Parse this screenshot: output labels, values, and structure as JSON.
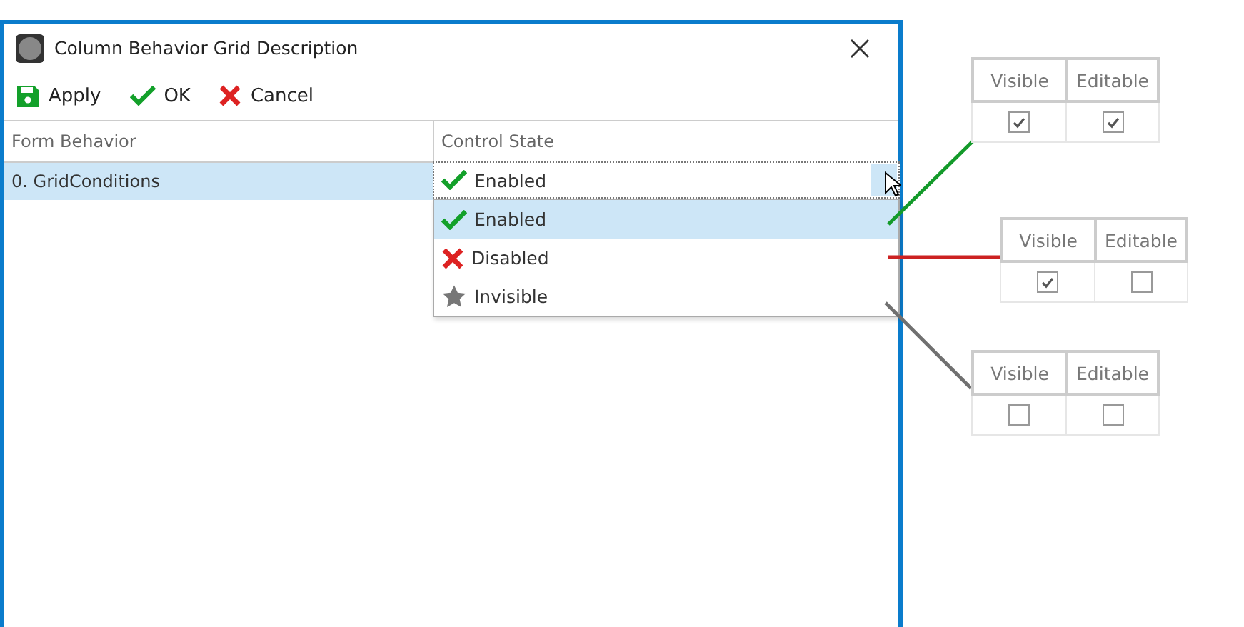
{
  "window": {
    "title": "Column Behavior Grid Description"
  },
  "toolbar": [
    {
      "label": "Apply",
      "kind": "save"
    },
    {
      "label": "OK",
      "kind": "ok"
    },
    {
      "label": "Cancel",
      "kind": "cancel"
    }
  ],
  "grid": {
    "columns": [
      "Form Behavior",
      "Control State"
    ],
    "rows": [
      {
        "form_behavior": "0. GridConditions",
        "control_state": "Enabled",
        "kind": "enabled",
        "selected": true
      }
    ]
  },
  "dropdown": {
    "options": [
      {
        "label": "Enabled",
        "kind": "enabled",
        "selected": true
      },
      {
        "label": "Disabled",
        "kind": "disabled",
        "selected": false
      },
      {
        "label": "Invisible",
        "kind": "invisible",
        "selected": false
      }
    ]
  },
  "callouts": [
    {
      "columns": [
        "Visible",
        "Editable"
      ],
      "visible": true,
      "editable": true,
      "color": "#139a2a"
    },
    {
      "columns": [
        "Visible",
        "Editable"
      ],
      "visible": true,
      "editable": false,
      "color": "#cc2222"
    },
    {
      "columns": [
        "Visible",
        "Editable"
      ],
      "visible": false,
      "editable": false,
      "color": "#707070"
    }
  ]
}
